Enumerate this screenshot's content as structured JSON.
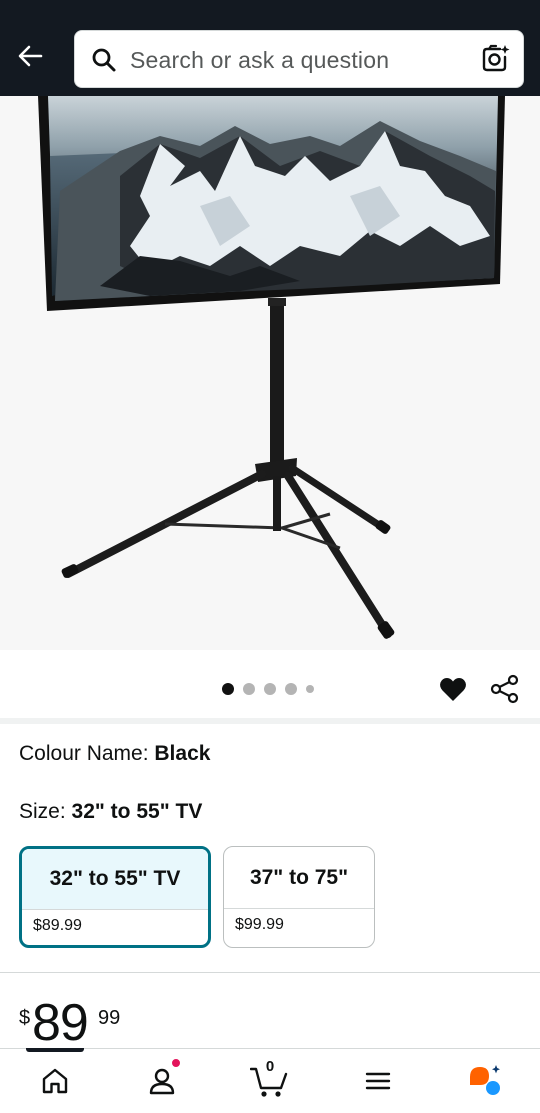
{
  "header": {
    "search_placeholder": "Search or ask a question"
  },
  "carousel": {
    "image_count": 5,
    "active_index": 0
  },
  "variations": {
    "colour_label": "Colour Name: ",
    "colour_value": "Black",
    "size_label": "Size: ",
    "size_value": "32\" to 55\" TV",
    "options": [
      {
        "name": "32\" to 55\" TV",
        "price": "$89.99",
        "selected": true
      },
      {
        "name": "37\" to 75\"",
        "price": "$99.99",
        "selected": false
      }
    ]
  },
  "price": {
    "symbol": "$",
    "whole": "89",
    "fraction": "99"
  },
  "bottom_nav": {
    "cart_count": "0",
    "items": [
      "home-icon",
      "account-icon",
      "cart-icon",
      "menu-icon",
      "rufus-icon"
    ]
  },
  "colors": {
    "header_bg": "#131921",
    "selected_border": "#007185",
    "selected_bg": "#e8f8fc",
    "notification": "#e3135b",
    "rufus_orange": "#ff6200",
    "rufus_blue": "#1a98ff"
  }
}
